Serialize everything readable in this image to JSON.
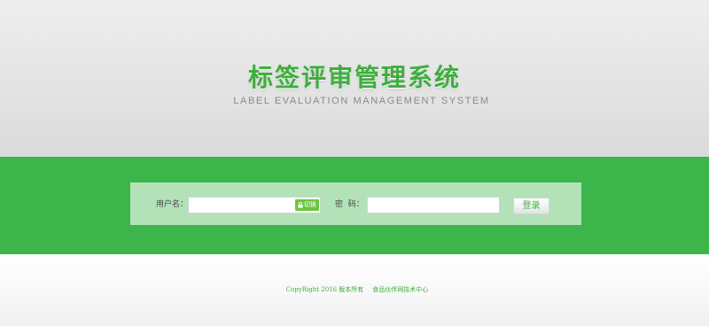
{
  "header": {
    "title": "标签评审管理系统",
    "subtitle": "LABEL EVALUATION MANAGEMENT SYSTEM"
  },
  "login": {
    "username_label": "用户名：",
    "username_value": "",
    "switch_label": "切换",
    "password_label": "密  码：",
    "password_value": "",
    "submit_label": "登录"
  },
  "footer": {
    "copyright": "CopyRight 2016 版本所有",
    "org": "食品伙伴网技术中心"
  },
  "colors": {
    "brand_green": "#3cb54a",
    "title_green": "#3fae3e",
    "box_bg": "#b3e2b8",
    "switch_green": "#6cc540"
  },
  "icons": {
    "switch": "lock-icon"
  }
}
